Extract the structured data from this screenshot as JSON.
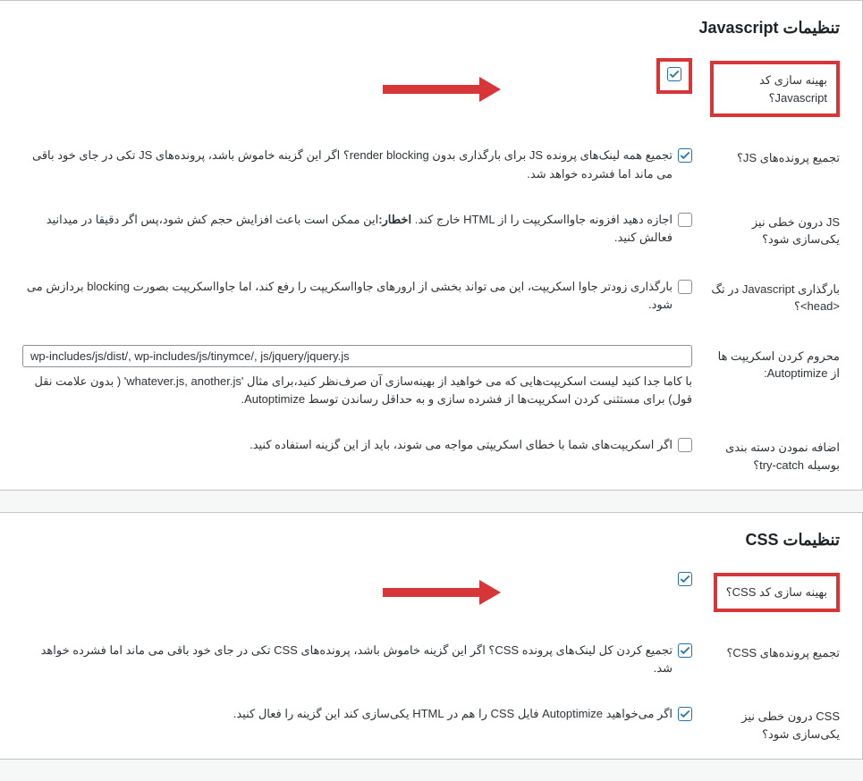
{
  "js": {
    "section_title": "تنظیمات Javascript",
    "rows": {
      "optimize": {
        "label": "بهینه سازی کد Javascript؟",
        "checked": true
      },
      "aggregate": {
        "label": "تجمیع پرونده‌های JS؟",
        "checked": true,
        "desc_pre": "تجمیع همه لینک‌های پرونده JS برای بارگذاری بدون render blocking؟ اگر این گزینه خاموش باشد، پرونده‌های JS تکی در جای خود باقی می ماند اما فشرده خواهد شد."
      },
      "inline": {
        "label": "JS درون خطی نیز یکی‌سازی شود؟",
        "checked": false,
        "desc_pre": "اجازه دهید افزونه جاوااسکریپت را از HTML خارج کند. ",
        "desc_bold": "اخطار:",
        "desc_post": "این ممکن است باعث افزایش حجم کش شود،پس اگر دقیقا در میدانید فعالش کنید."
      },
      "head": {
        "label": "بارگذاری Javascript در تگ <head>؟",
        "checked": false,
        "desc": "بارگذاری زودتر جاوا اسکریپت، این می تواند بخشی از ارورهای جاوااسکریپت را رفع کند، اما جاوااسکریپت بصورت blocking بردازش می شود."
      },
      "exclude": {
        "label": "محروم کردن اسکریپت ها از Autoptimize:",
        "value": "wp-includes/js/dist/, wp-includes/js/tinymce/, js/jquery/jquery.js",
        "desc": "با کاما جدا کنید لیست اسکریپت‌هایی که می خواهید از بهینه‌سازی آن صرف‌نظر کنید،برای مثال 'whatever.js, another.js' ( بدون علامت نقل قول) برای مستثنی کردن اسکریپت‌ها از فشرده سازی و به حداقل رساندن توسط Autoptimize."
      },
      "trycatch": {
        "label": "اضافه نمودن دسته بندی بوسیله try-catch؟",
        "checked": false,
        "desc": "اگر اسکریپت‌های شما با خطای اسکریپتی مواجه می شوند، باید از این گزینه استفاده کنید."
      }
    }
  },
  "css": {
    "section_title": "تنظیمات CSS",
    "rows": {
      "optimize": {
        "label": "بهینه سازی کد CSS؟",
        "checked": true
      },
      "aggregate": {
        "label": "تجمیع پرونده‌های CSS؟",
        "checked": true,
        "desc": "تجمیع کردن کل لینک‌های پرونده CSS؟ اگر این گزینه خاموش باشد، پرونده‌های CSS تکی در جای خود باقی می ماند اما فشرده خواهد شد."
      },
      "inline": {
        "label": "CSS درون خطی نیز یکی‌سازی شود؟",
        "checked": true,
        "desc": "اگر می‌خواهید Autoptimize فایل CSS را هم در HTML یکی‌سازی کند این گزینه را فعال کنید."
      }
    }
  }
}
